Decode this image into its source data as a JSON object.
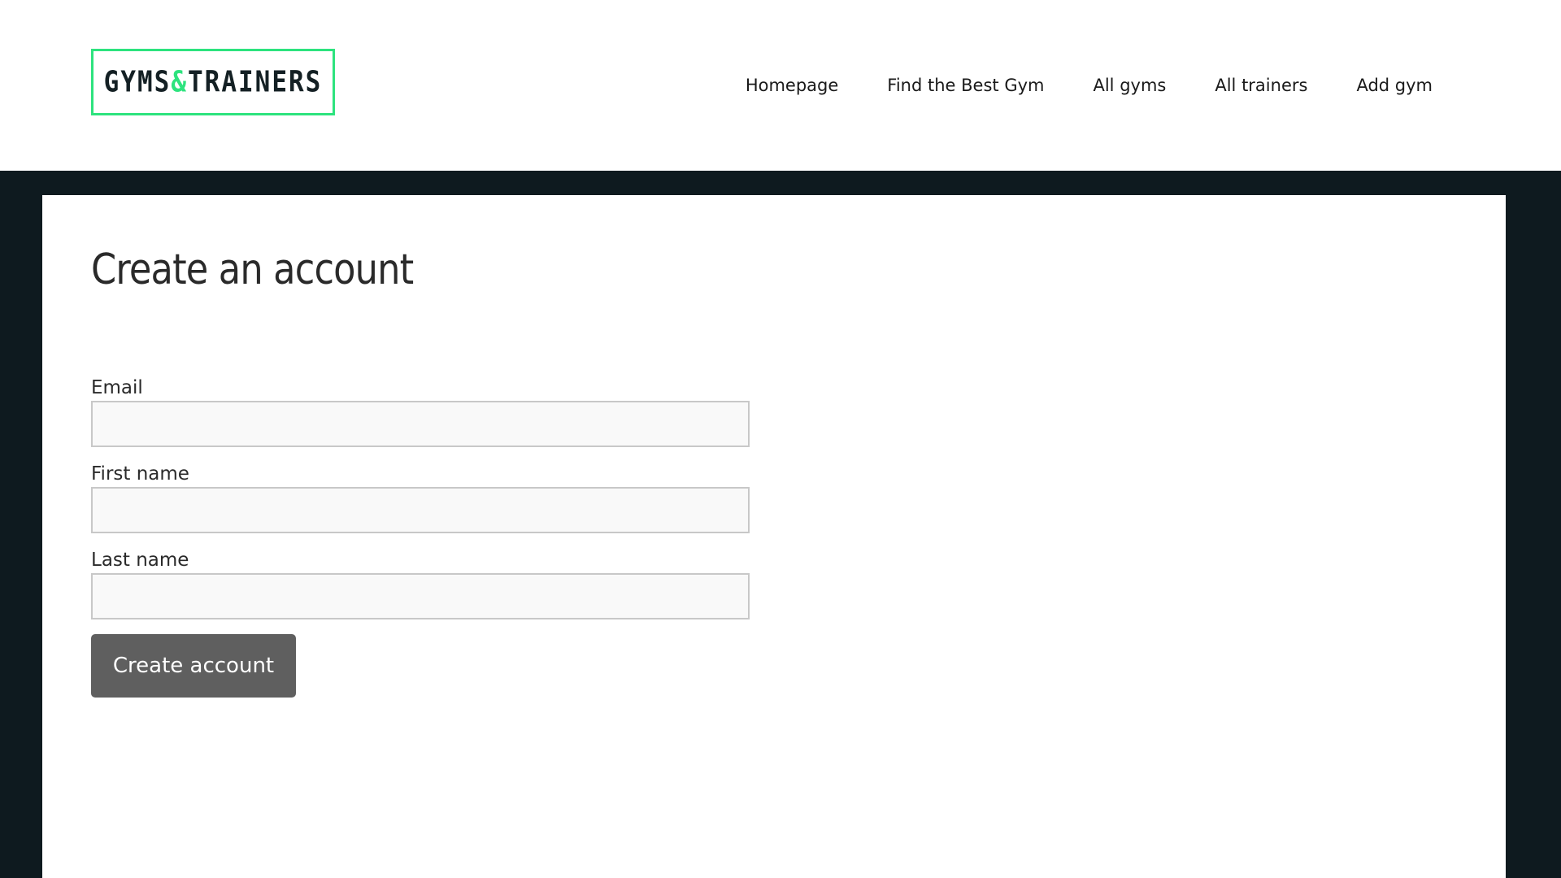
{
  "header": {
    "logo": {
      "part1": "GYMS",
      "amp": "&",
      "part2": "TRAINERS"
    },
    "nav": [
      {
        "label": "Homepage"
      },
      {
        "label": "Find the Best Gym"
      },
      {
        "label": "All gyms"
      },
      {
        "label": "All trainers"
      },
      {
        "label": "Add gym"
      }
    ]
  },
  "main": {
    "title": "Create an account",
    "fields": {
      "email": {
        "label": "Email",
        "value": "",
        "placeholder": ""
      },
      "first_name": {
        "label": "First name",
        "value": "",
        "placeholder": ""
      },
      "last_name": {
        "label": "Last name",
        "value": "",
        "placeholder": ""
      }
    },
    "submit_label": "Create account"
  },
  "colors": {
    "accent": "#2de37e",
    "dark_background": "#0e1a1f",
    "button": "#5f5f5f"
  }
}
